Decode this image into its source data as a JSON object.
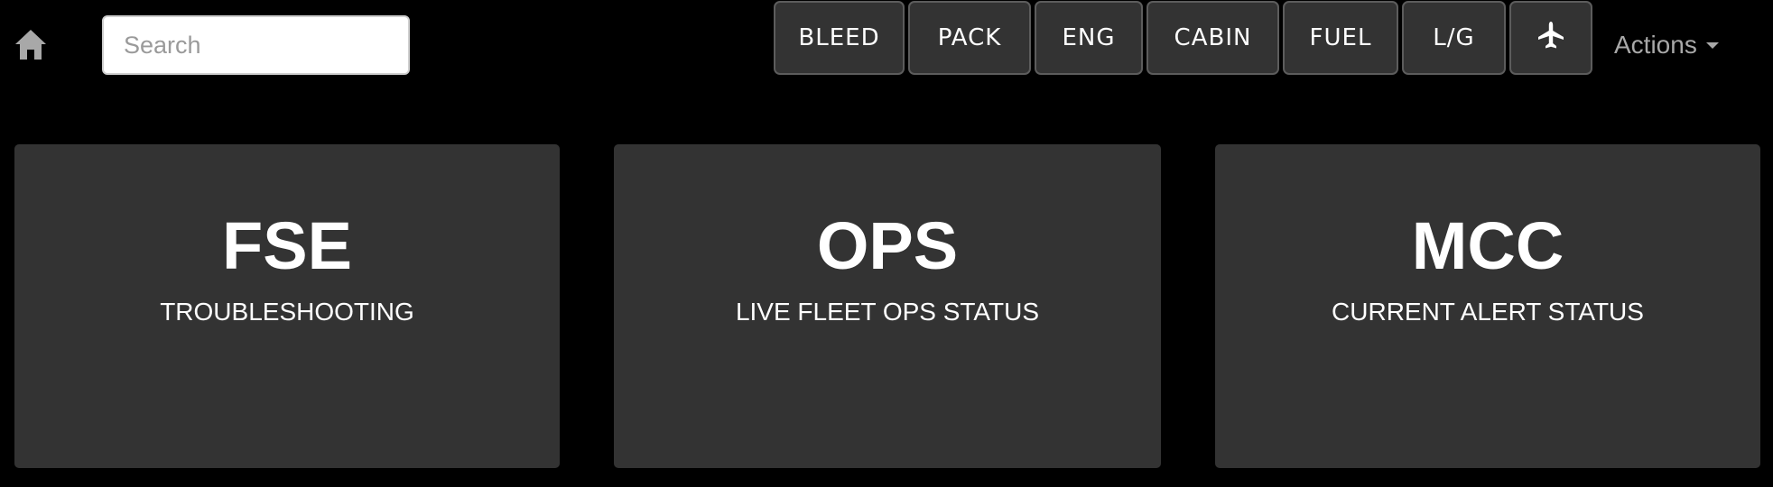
{
  "header": {
    "search_placeholder": "Search",
    "system_buttons": [
      {
        "label": "BLEED"
      },
      {
        "label": "PACK"
      },
      {
        "label": "ENG"
      },
      {
        "label": "CABIN"
      },
      {
        "label": "FUEL"
      },
      {
        "label": "L/G"
      }
    ],
    "aircraft_icon": "airplane-icon",
    "home_icon": "home-icon",
    "actions_label": "Actions"
  },
  "cards": [
    {
      "title": "FSE",
      "subtitle": "TROUBLESHOOTING"
    },
    {
      "title": "OPS",
      "subtitle": "LIVE FLEET OPS STATUS"
    },
    {
      "title": "MCC",
      "subtitle": "CURRENT ALERT STATUS"
    }
  ],
  "colors": {
    "background": "#000000",
    "panel": "#333333",
    "button_border": "#5c5c5c",
    "muted_text": "#a8a8a8"
  }
}
